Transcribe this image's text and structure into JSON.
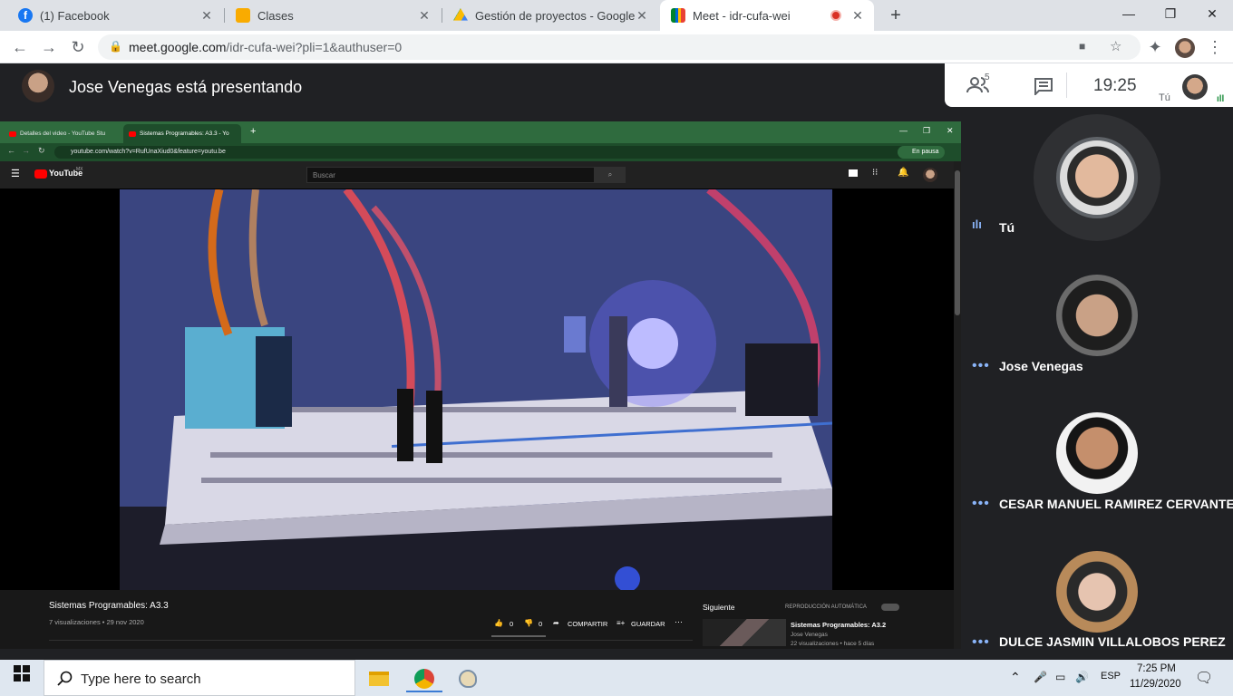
{
  "browser": {
    "tabs": [
      {
        "title": "(1) Facebook",
        "icon": "facebook-icon"
      },
      {
        "title": "Clases",
        "icon": "classroom-icon"
      },
      {
        "title": "Gestión de proyectos - Google D",
        "icon": "google-drive-icon"
      },
      {
        "title": "Meet - idr-cufa-wei",
        "icon": "meet-icon",
        "active": true
      }
    ],
    "url_host": "meet.google.com",
    "url_path": "/idr-cufa-wei?pli=1&authuser=0"
  },
  "meet": {
    "presenting_title": "Jose Venegas está presentando",
    "participant_count": "5",
    "time": "19:25",
    "self_label": "Tú"
  },
  "shared_screen": {
    "tabs": [
      "Detalles del video - YouTube Stu",
      "Sistemas Programables: A3.3 - Yo"
    ],
    "url": "youtube.com/watch?v=RufUnaXiud0&feature=youtu.be",
    "paused_label": "En pausa",
    "youtube_logo": "YouTube",
    "youtube_region": "MX",
    "search_placeholder": "Buscar",
    "video_title": "Sistemas Programables: A3.3",
    "video_meta": "7 visualizaciones • 29 nov 2020",
    "likes": "0",
    "dislikes": "0",
    "share_label": "COMPARTIR",
    "save_label": "GUARDAR",
    "next_label": "Siguiente",
    "autoplay_label": "REPRODUCCIÓN AUTOMÁTICA",
    "next_video": {
      "title": "Sistemas Programables: A3.2",
      "channel": "Jose Venegas",
      "meta": "22 visualizaciones • hace 5 días"
    }
  },
  "participants": [
    {
      "name": "Tú"
    },
    {
      "name": "Jose Venegas"
    },
    {
      "name": "CESAR MANUEL RAMIREZ CERVANTES"
    },
    {
      "name": "DULCE JASMIN VILLALOBOS PEREZ"
    }
  ],
  "taskbar": {
    "search_placeholder": "Type here to search",
    "language": "ESP",
    "time": "7:25 PM",
    "date": "11/29/2020"
  },
  "colors": {
    "meet_background": "#202124",
    "speaking_indicator": "#8ab4f8",
    "taskbar": "#dfe7f0"
  }
}
